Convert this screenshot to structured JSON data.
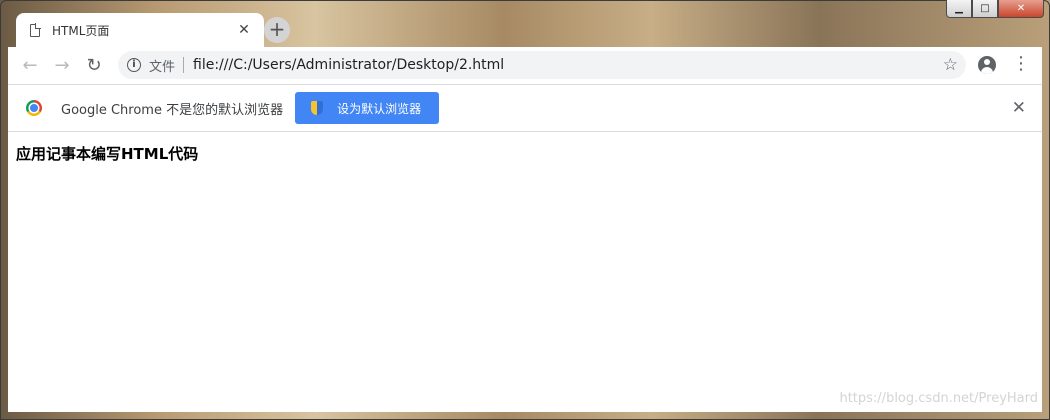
{
  "window": {
    "min_glyph": "▁",
    "max_glyph": "□",
    "close_glyph": "✕"
  },
  "tab": {
    "title": "HTML页面",
    "close_glyph": "✕",
    "new_tab_glyph": "+"
  },
  "toolbar": {
    "back_glyph": "←",
    "forward_glyph": "→",
    "reload_glyph": "↻",
    "info_glyph": "i",
    "scheme_label": "文件",
    "url": "file:///C:/Users/Administrator/Desktop/2.html",
    "star_glyph": "☆",
    "menu_glyph": "⋮"
  },
  "infobar": {
    "message": "Google Chrome 不是您的默认浏览器",
    "button_label": "设为默认浏览器",
    "close_glyph": "✕"
  },
  "page": {
    "heading": "应用记事本编写HTML代码",
    "watermark": "https://blog.csdn.net/PreyHard"
  },
  "colors": {
    "accent_button": "#4285f4",
    "close_button": "#c9452d"
  }
}
